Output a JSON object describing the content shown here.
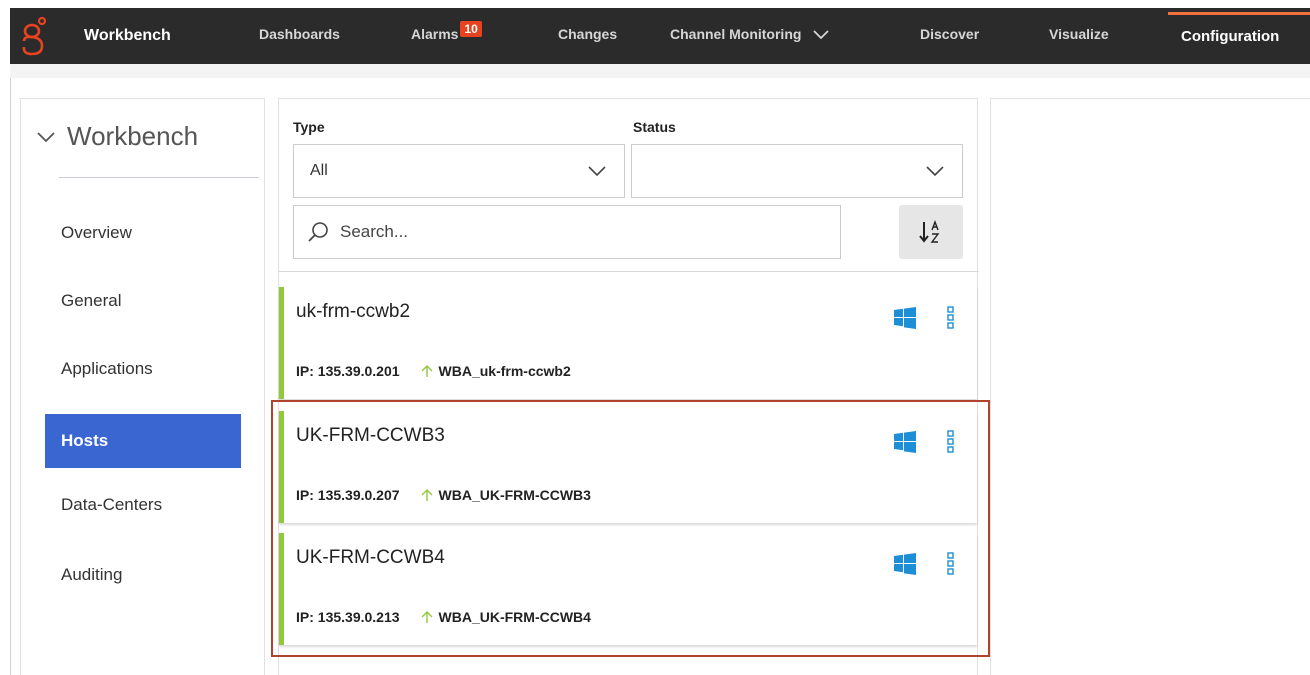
{
  "app": {
    "brand": "Workbench"
  },
  "nav": {
    "dashboards": "Dashboards",
    "alarms": "Alarms",
    "alarms_count": "10",
    "changes": "Changes",
    "channel_monitoring": "Channel Monitoring",
    "discover": "Discover",
    "visualize": "Visualize",
    "configuration": "Configuration"
  },
  "sidebar": {
    "title": "Workbench",
    "items": [
      {
        "label": "Overview",
        "active": false
      },
      {
        "label": "General",
        "active": false
      },
      {
        "label": "Applications",
        "active": false
      },
      {
        "label": "Hosts",
        "active": true
      },
      {
        "label": "Data-Centers",
        "active": false
      },
      {
        "label": "Auditing",
        "active": false
      }
    ]
  },
  "filters": {
    "type_label": "Type",
    "type_value": "All",
    "status_label": "Status",
    "status_value": "",
    "search_placeholder": "Search...",
    "sort_icon": "sort-alpha-icon"
  },
  "hosts": [
    {
      "name": "uk-frm-ccwb2",
      "ip": "IP: 135.39.0.201",
      "app": "WBA_uk-frm-ccwb2"
    },
    {
      "name": "UK-FRM-CCWB3",
      "ip": "IP: 135.39.0.207",
      "app": "WBA_UK-FRM-CCWB3"
    },
    {
      "name": "UK-FRM-CCWB4",
      "ip": "IP: 135.39.0.213",
      "app": "WBA_UK-FRM-CCWB4"
    }
  ],
  "colors": {
    "nav_bg": "#2b2b2b",
    "accent_orange": "#f0713b",
    "active_blue": "#3a66d1",
    "status_green": "#93c83e",
    "windows_blue": "#1e8fd6",
    "highlight_red": "#b0432c"
  }
}
